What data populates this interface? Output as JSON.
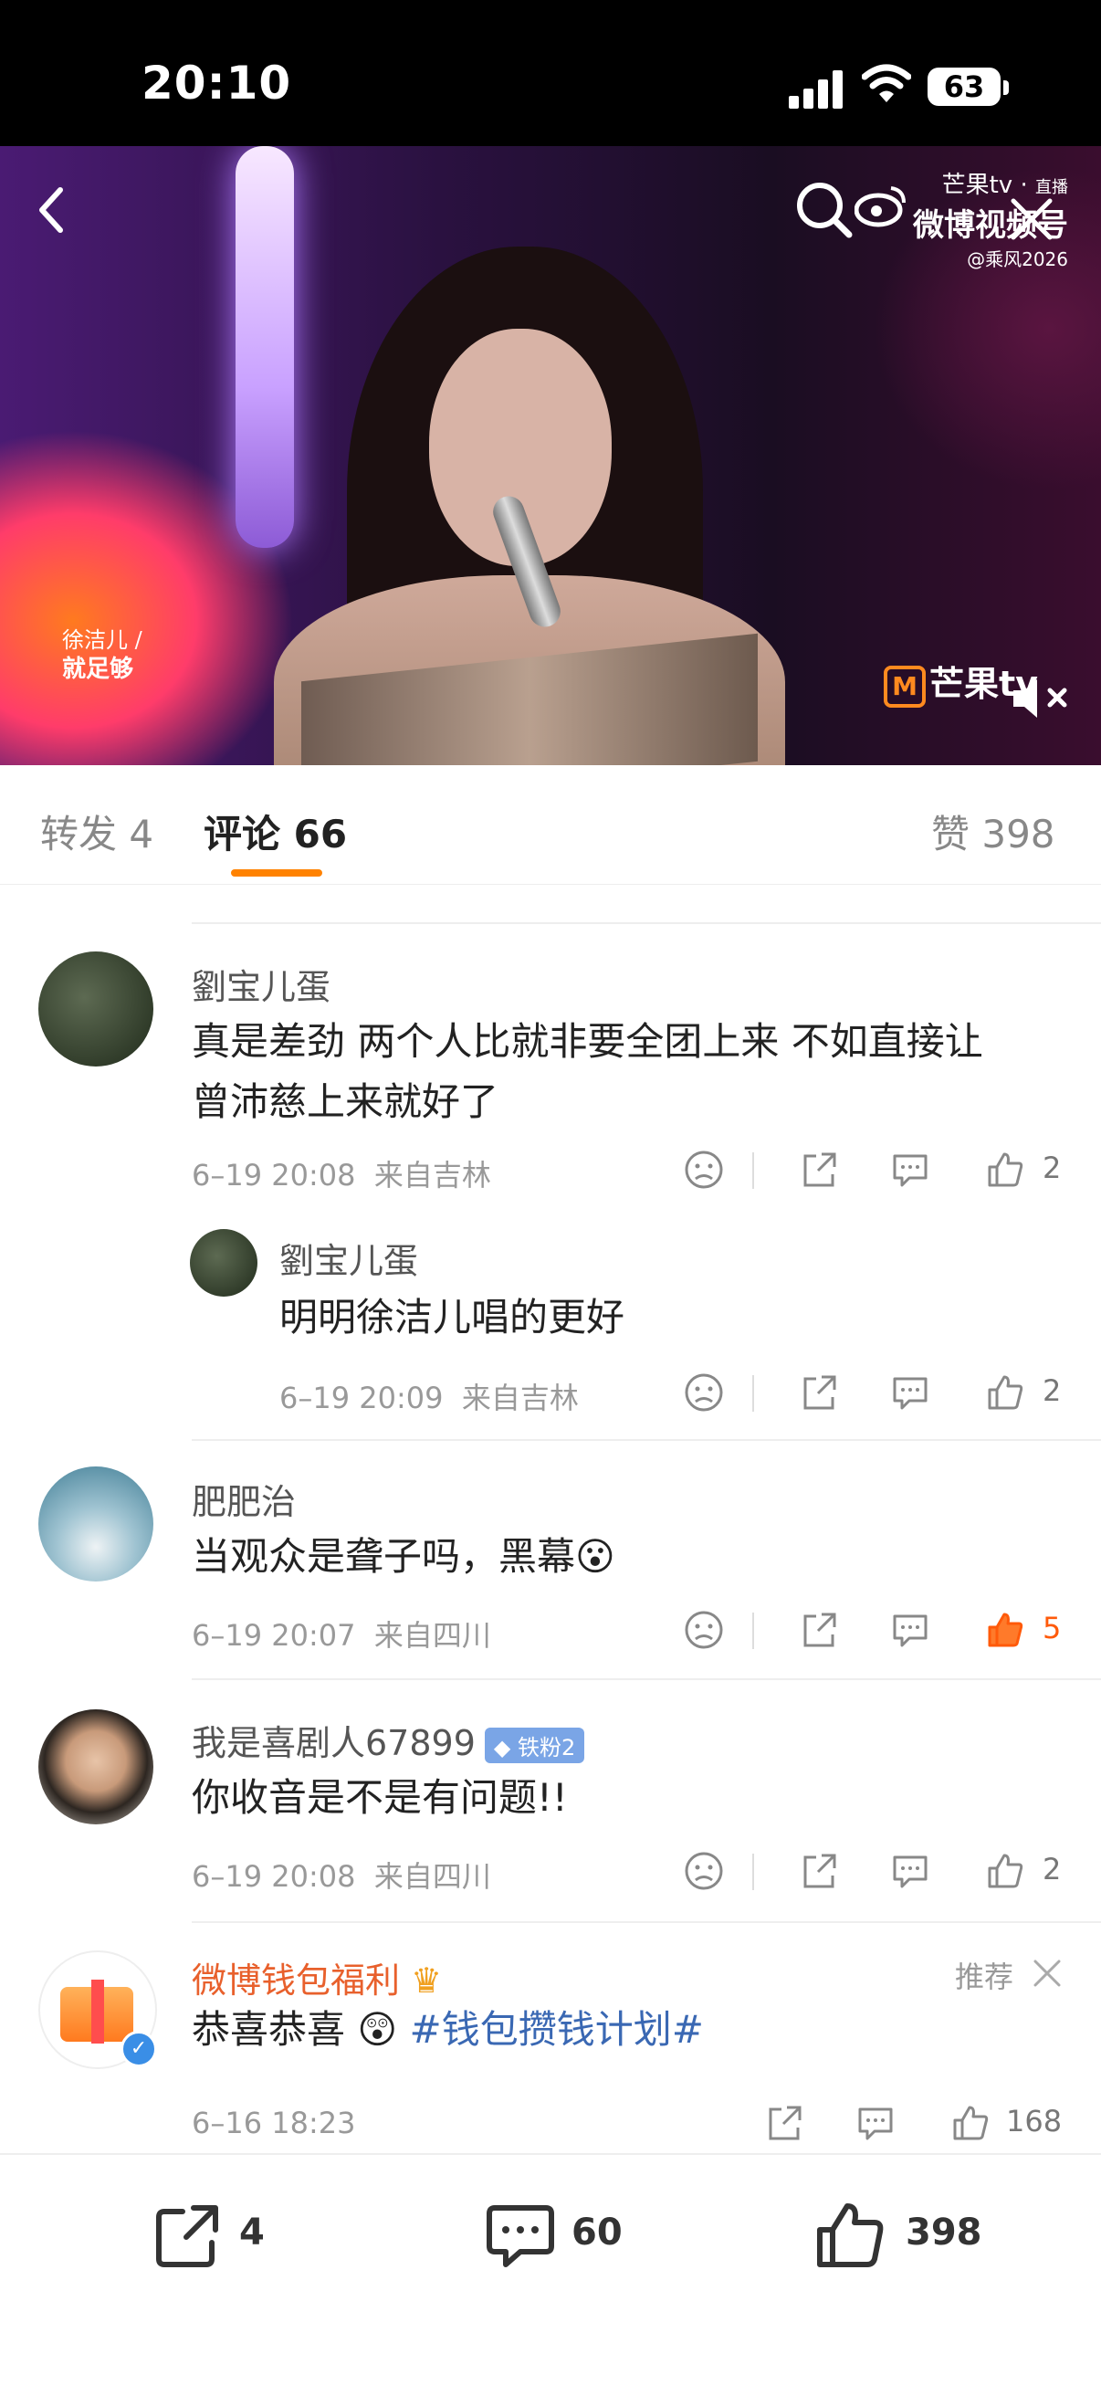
{
  "status_bar": {
    "time": "20:10",
    "battery": "63"
  },
  "video": {
    "watermark_brand": "芒果tv",
    "watermark_sub": "微博视频号",
    "watermark_handle": "@乘风2026",
    "live_tag": "直播",
    "caption_line1": "徐洁儿 /",
    "caption_line2": "就足够",
    "logo_text": "芒果tv"
  },
  "tabs": {
    "repost": "转发 4",
    "comments": "评论 66",
    "likes": "赞 398"
  },
  "comments": [
    {
      "user": "劉宝儿蛋",
      "text_line1": "真是差劲 两个人比就非要全团上来  不如直接让",
      "text_line2": "曾沛慈上来就好了",
      "time": "6–19 20:08",
      "location": "来自吉林",
      "likes": "2"
    },
    {
      "user": "劉宝儿蛋",
      "text": "明明徐洁儿唱的更好",
      "time": "6–19 20:09",
      "location": "来自吉林",
      "likes": "2"
    },
    {
      "user": "肥肥治",
      "text": "当观众是聋子吗，黑幕",
      "emoji": "😮",
      "time": "6–19 20:07",
      "location": "来自四川",
      "likes": "5"
    },
    {
      "user": "我是喜剧人67899",
      "badge": "铁粉2",
      "text": "你收音是不是有问题!!",
      "time": "6–19 20:08",
      "location": "来自四川",
      "likes": "2"
    }
  ],
  "ad": {
    "user": "微博钱包福利",
    "text": "恭喜恭喜",
    "hashtag": "#钱包攒钱计划#",
    "time": "6–16 18:23",
    "likes": "168",
    "recommend_label": "推荐"
  },
  "bottom_bar": {
    "repost_count": "4",
    "comment_count": "60",
    "like_count": "398"
  }
}
